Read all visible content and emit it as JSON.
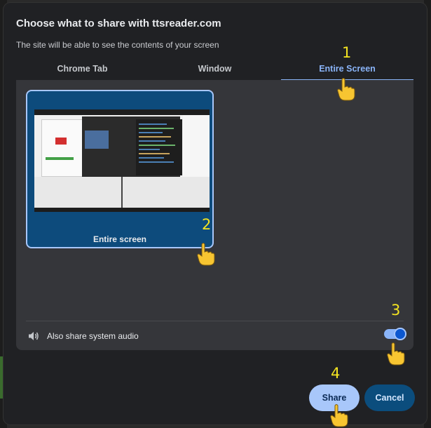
{
  "dialog": {
    "title": "Choose what to share with ttsreader.com",
    "subtitle": "The site will be able to see the contents of your screen"
  },
  "tabs": [
    {
      "label": "Chrome Tab",
      "active": false
    },
    {
      "label": "Window",
      "active": false
    },
    {
      "label": "Entire Screen",
      "active": true
    }
  ],
  "screen_option": {
    "label": "Entire screen",
    "selected": true
  },
  "audio": {
    "label": "Also share system audio",
    "enabled": true,
    "icon": "speaker-icon"
  },
  "buttons": {
    "share": "Share",
    "cancel": "Cancel"
  },
  "annotations": {
    "step1": "1",
    "step2": "2",
    "step3": "3",
    "step4": "4"
  },
  "colors": {
    "accent": "#8ab4f8",
    "annotation": "#f3e321",
    "share_bg": "#a8c7fa",
    "cancel_bg": "#0b4d7d"
  }
}
